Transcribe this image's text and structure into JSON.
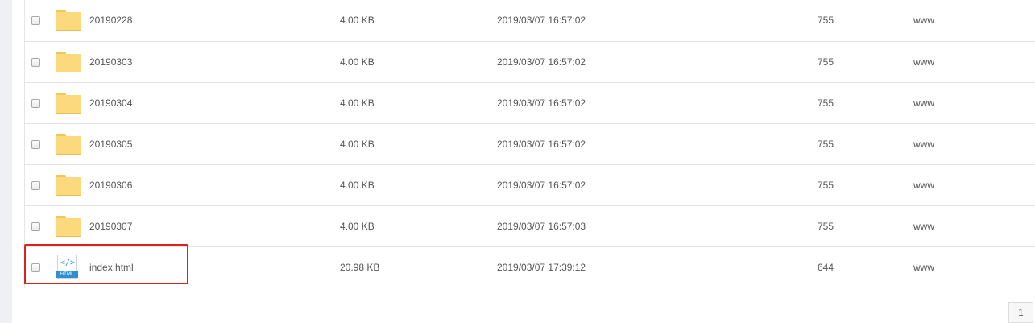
{
  "files": [
    {
      "name": "20190228",
      "size": "4.00 KB",
      "modified": "2019/03/07 16:57:02",
      "permission": "755",
      "owner": "www",
      "icon": "folder-icon"
    },
    {
      "name": "20190303",
      "size": "4.00 KB",
      "modified": "2019/03/07 16:57:02",
      "permission": "755",
      "owner": "www",
      "icon": "folder-icon"
    },
    {
      "name": "20190304",
      "size": "4.00 KB",
      "modified": "2019/03/07 16:57:02",
      "permission": "755",
      "owner": "www",
      "icon": "folder-icon"
    },
    {
      "name": "20190305",
      "size": "4.00 KB",
      "modified": "2019/03/07 16:57:02",
      "permission": "755",
      "owner": "www",
      "icon": "folder-icon"
    },
    {
      "name": "20190306",
      "size": "4.00 KB",
      "modified": "2019/03/07 16:57:02",
      "permission": "755",
      "owner": "www",
      "icon": "folder-icon"
    },
    {
      "name": "20190307",
      "size": "4.00 KB",
      "modified": "2019/03/07 16:57:03",
      "permission": "755",
      "owner": "www",
      "icon": "folder-icon"
    },
    {
      "name": "index.html",
      "size": "20.98 KB",
      "modified": "2019/03/07 17:39:12",
      "permission": "644",
      "owner": "www",
      "icon": "html-file-icon"
    }
  ],
  "html_icon": {
    "code": "</>",
    "badge": "HTML"
  },
  "highlight_color": "#e0201c",
  "pagination": {
    "current_page": "1"
  }
}
